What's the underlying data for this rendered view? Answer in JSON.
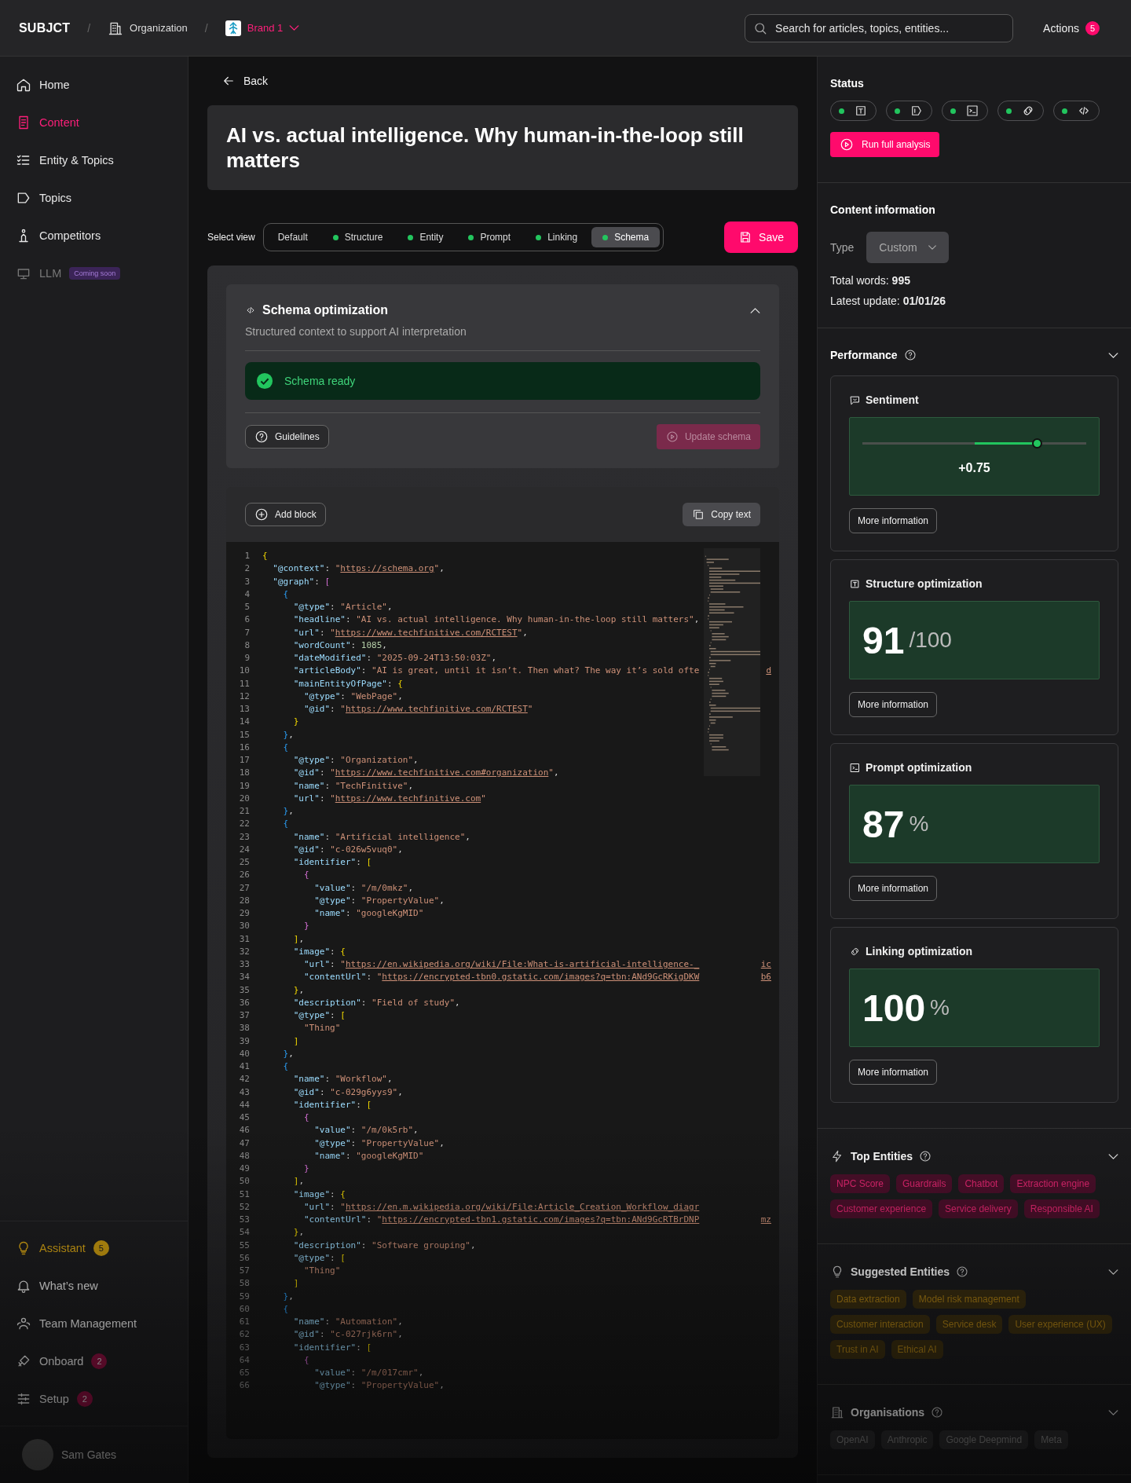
{
  "header": {
    "logo": "SUBJCT",
    "separators": [
      "/",
      "/"
    ],
    "organization": "Organization",
    "brand": "Brand 1",
    "search": {
      "placeholder": "Search for articles, topics, entities..."
    },
    "actions": {
      "label": "Actions",
      "count": "5"
    }
  },
  "sidebar": {
    "items": [
      {
        "label": "Home",
        "selected": false,
        "disabled": false
      },
      {
        "label": "Content",
        "selected": true,
        "disabled": false
      },
      {
        "label": "Entity & Topics",
        "selected": false,
        "disabled": false
      },
      {
        "label": "Topics",
        "selected": false,
        "disabled": false
      },
      {
        "label": "Competitors",
        "selected": false,
        "disabled": false
      },
      {
        "label": "LLM",
        "selected": false,
        "disabled": true,
        "badge": "Coming soon"
      }
    ],
    "bottom_items": [
      {
        "label": "Assistant",
        "highlighted": true,
        "badge": "5"
      },
      {
        "label": "What’s new",
        "highlighted": false
      },
      {
        "label": "Team Management",
        "highlighted": false
      },
      {
        "label": "Onboard",
        "highlighted": false,
        "badge": "2"
      },
      {
        "label": "Setup",
        "highlighted": false,
        "badge": "2"
      }
    ],
    "user": {
      "name": "Sam Gates"
    }
  },
  "main": {
    "back": "Back",
    "title": "AI vs. actual intelligence. Why human-in-the-loop still matters",
    "view_label": "Select view",
    "views": [
      {
        "label": "Default",
        "selected": false,
        "status_dot": false
      },
      {
        "label": "Structure",
        "selected": false,
        "status_dot": true
      },
      {
        "label": "Entity",
        "selected": false,
        "status_dot": true
      },
      {
        "label": "Prompt",
        "selected": false,
        "status_dot": true
      },
      {
        "label": "Linking",
        "selected": false,
        "status_dot": true
      },
      {
        "label": "Schema",
        "selected": true,
        "status_dot": true
      }
    ],
    "save": "Save",
    "schema_card": {
      "title": "Schema optimization",
      "subtitle": "Structured context to support AI interpretation",
      "status": "Schema ready",
      "guidelines": "Guidelines",
      "update": {
        "label": "Update schema",
        "disabled": true
      }
    },
    "editor": {
      "add_block": "Add block",
      "copy": "Copy text",
      "lines": [
        {
          "n": "1",
          "code": "{"
        },
        {
          "n": "2",
          "code": "  \"@context\": \"https://schema.org\","
        },
        {
          "n": "3",
          "code": "  \"@graph\": ["
        },
        {
          "n": "4",
          "code": "    {"
        },
        {
          "n": "5",
          "code": "      \"@type\": \"Article\","
        },
        {
          "n": "6",
          "code": "      \"headline\": \"AI vs. actual intelligence. Why human-in-the-loop still matters\","
        },
        {
          "n": "7",
          "code": "      \"url\": \"https://www.techfinitive.com/RCTEST\","
        },
        {
          "n": "8",
          "code": "      \"wordCount\": 1085,"
        },
        {
          "n": "9",
          "code": "      \"dateModified\": \"2025-09-24T13:50:03Z\","
        },
        {
          "n": "10",
          "code": "      \"articleBody\": \"AI is great, until it isn’t. Then what? The way it’s sold ofte",
          "tail": "d"
        },
        {
          "n": "11",
          "code": "      \"mainEntityOfPage\": {"
        },
        {
          "n": "12",
          "code": "        \"@type\": \"WebPage\","
        },
        {
          "n": "13",
          "code": "        \"@id\": \"https://www.techfinitive.com/RCTEST\""
        },
        {
          "n": "14",
          "code": "      }"
        },
        {
          "n": "15",
          "code": "    },"
        },
        {
          "n": "16",
          "code": "    {"
        },
        {
          "n": "17",
          "code": "      \"@type\": \"Organization\","
        },
        {
          "n": "18",
          "code": "      \"@id\": \"https://www.techfinitive.com#organization\","
        },
        {
          "n": "19",
          "code": "      \"name\": \"TechFinitive\","
        },
        {
          "n": "20",
          "code": "      \"url\": \"https://www.techfinitive.com\""
        },
        {
          "n": "21",
          "code": "    },"
        },
        {
          "n": "22",
          "code": "    {"
        },
        {
          "n": "23",
          "code": "      \"name\": \"Artificial intelligence\","
        },
        {
          "n": "24",
          "code": "      \"@id\": \"c-026w5vuq0\","
        },
        {
          "n": "25",
          "code": "      \"identifier\": ["
        },
        {
          "n": "26",
          "code": "        {"
        },
        {
          "n": "27",
          "code": "          \"value\": \"/m/0mkz\","
        },
        {
          "n": "28",
          "code": "          \"@type\": \"PropertyValue\","
        },
        {
          "n": "29",
          "code": "          \"name\": \"googleKgMID\""
        },
        {
          "n": "30",
          "code": "        }"
        },
        {
          "n": "31",
          "code": "      ],"
        },
        {
          "n": "32",
          "code": "      \"image\": {"
        },
        {
          "n": "33",
          "code": "        \"url\": \"https://en.wikipedia.org/wiki/File:What-is-artificial-intelligence-_",
          "tail": "ic"
        },
        {
          "n": "34",
          "code": "        \"contentUrl\": \"https://encrypted-tbn0.gstatic.com/images?q=tbn:ANd9GcRKigDKW",
          "tail": "b6"
        },
        {
          "n": "35",
          "code": "      },"
        },
        {
          "n": "36",
          "code": "      \"description\": \"Field of study\","
        },
        {
          "n": "37",
          "code": "      \"@type\": ["
        },
        {
          "n": "38",
          "code": "        \"Thing\""
        },
        {
          "n": "39",
          "code": "      ]"
        },
        {
          "n": "40",
          "code": "    },"
        },
        {
          "n": "41",
          "code": "    {"
        },
        {
          "n": "42",
          "code": "      \"name\": \"Workflow\","
        },
        {
          "n": "43",
          "code": "      \"@id\": \"c-029g6yys9\","
        },
        {
          "n": "44",
          "code": "      \"identifier\": ["
        },
        {
          "n": "45",
          "code": "        {"
        },
        {
          "n": "46",
          "code": "          \"value\": \"/m/0k5rb\","
        },
        {
          "n": "47",
          "code": "          \"@type\": \"PropertyValue\","
        },
        {
          "n": "48",
          "code": "          \"name\": \"googleKgMID\""
        },
        {
          "n": "49",
          "code": "        }"
        },
        {
          "n": "50",
          "code": "      ],"
        },
        {
          "n": "51",
          "code": "      \"image\": {"
        },
        {
          "n": "52",
          "code": "        \"url\": \"https://en.m.wikipedia.org/wiki/File:Article_Creation_Workflow_diagr"
        },
        {
          "n": "53",
          "code": "        \"contentUrl\": \"https://encrypted-tbn1.gstatic.com/images?q=tbn:ANd9GcRTBrDNP",
          "tail": "mz"
        },
        {
          "n": "54",
          "code": "      },"
        },
        {
          "n": "55",
          "code": "      \"description\": \"Software grouping\","
        },
        {
          "n": "56",
          "code": "      \"@type\": ["
        },
        {
          "n": "57",
          "code": "        \"Thing\""
        },
        {
          "n": "58",
          "code": "      ]"
        },
        {
          "n": "59",
          "code": "    },"
        },
        {
          "n": "60",
          "code": "    {"
        },
        {
          "n": "61",
          "code": "      \"name\": \"Automation\","
        },
        {
          "n": "62",
          "code": "      \"@id\": \"c-027rjk6rn\","
        },
        {
          "n": "63",
          "code": "      \"identifier\": ["
        },
        {
          "n": "64",
          "code": "        {"
        },
        {
          "n": "65",
          "code": "          \"value\": \"/m/017cmr\","
        },
        {
          "n": "66",
          "code": "          \"@type\": \"PropertyValue\","
        }
      ]
    }
  },
  "right_panel": {
    "status": {
      "title": "Status",
      "chips": [
        {
          "ok": true
        },
        {
          "ok": true
        },
        {
          "ok": true
        },
        {
          "ok": true
        },
        {
          "ok": true
        }
      ],
      "run": "Run full analysis"
    },
    "content_info": {
      "title": "Content information",
      "type_label": "Type",
      "type_value": "Custom",
      "total_words": "Total words: **995**",
      "latest_update": "Latest update: **01/01/26**"
    },
    "performance": {
      "title": "Performance",
      "cards": [
        {
          "kind": "slider",
          "title": "Sentiment",
          "level": 0.78,
          "reading": "+0.75",
          "button": "More information"
        },
        {
          "kind": "score",
          "title": "Structure optimization",
          "value": "91",
          "unit": "/100",
          "button": "More information"
        },
        {
          "kind": "score",
          "title": "Prompt optimization",
          "value": "87",
          "unit": "%",
          "button": "More information"
        },
        {
          "kind": "score",
          "title": "Linking optimization",
          "value": "100",
          "unit": "%",
          "button": "More information"
        }
      ]
    },
    "entity_sections": [
      {
        "kind": "top",
        "title": "Top Entities",
        "tags": [
          "NPC Score",
          "Guardrails",
          "Chatbot",
          "Extraction engine",
          "Customer experience",
          "Service delivery",
          "Responsible AI"
        ]
      },
      {
        "kind": "suggested",
        "title": "Suggested Entities",
        "tags": [
          "Data extraction",
          "Model risk management",
          "Customer interaction",
          "Service desk",
          "User experience (UX)",
          "Trust in AI",
          "Ethical AI"
        ]
      },
      {
        "kind": "organisations",
        "title": "Organisations",
        "tags": [
          "OpenAI",
          "Anthropic",
          "Google Deepmind",
          "Meta"
        ]
      }
    ]
  }
}
